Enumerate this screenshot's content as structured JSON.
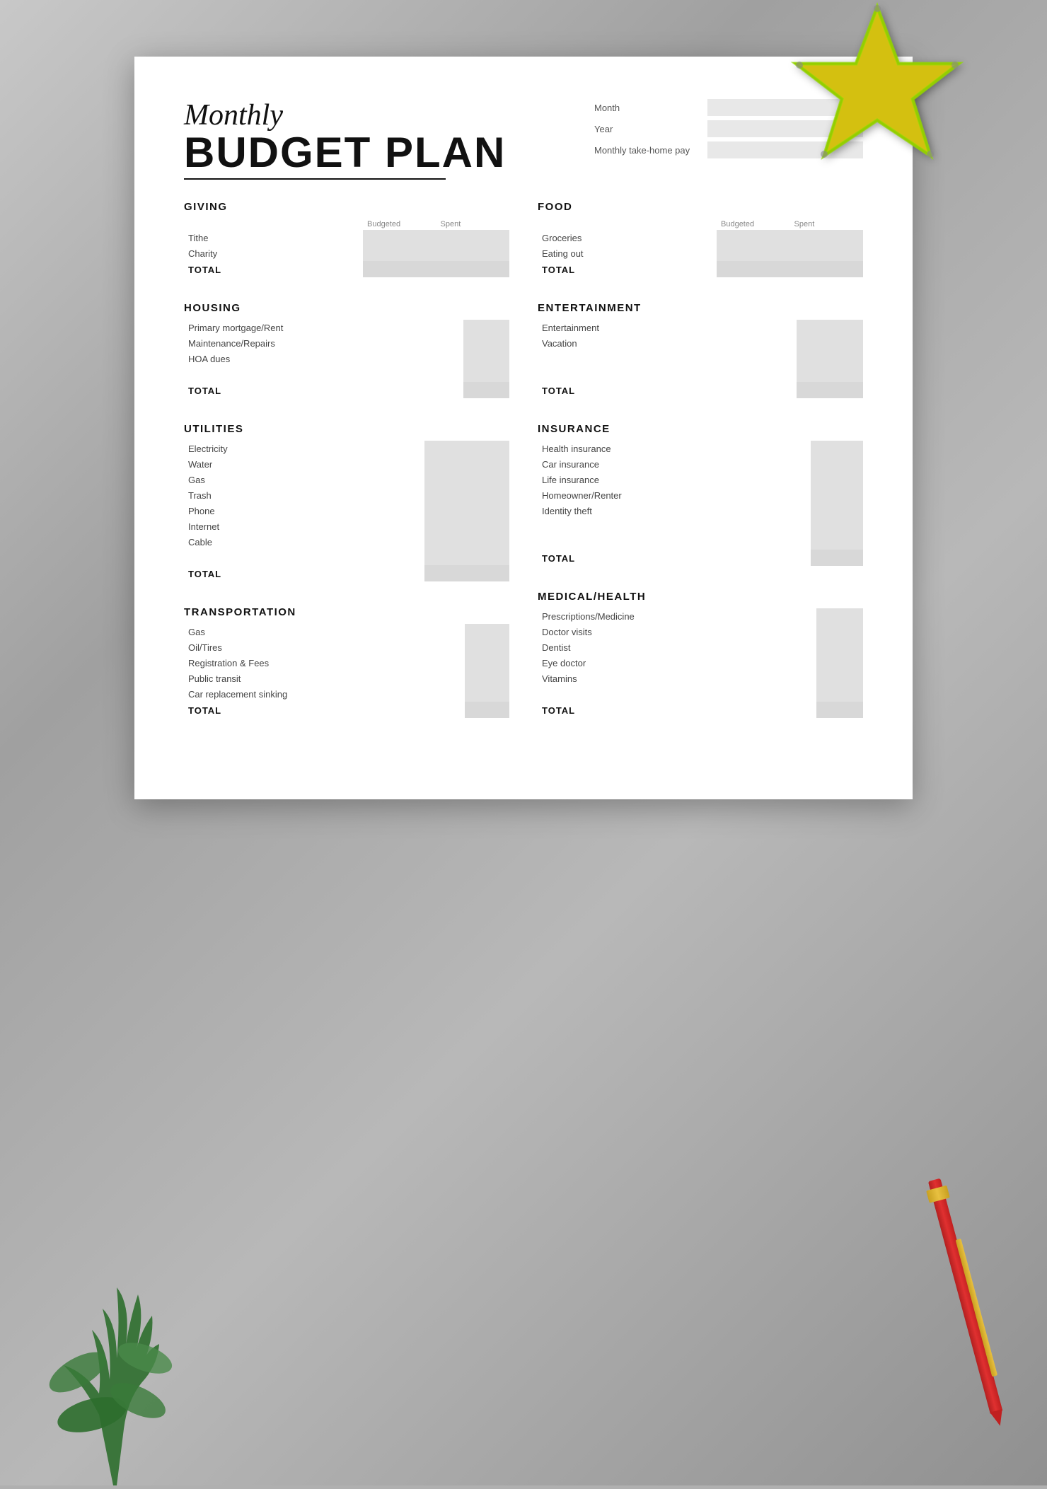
{
  "document": {
    "title_monthly": "Monthly",
    "title_budget": "BUDGET PLAN",
    "info_fields": [
      {
        "label": "Month",
        "value": ""
      },
      {
        "label": "Year",
        "value": ""
      },
      {
        "label": "Monthly take-home pay",
        "value": ""
      }
    ],
    "sections": {
      "left": [
        {
          "id": "giving",
          "title": "GIVING",
          "headers": {
            "col1": "Budgeted",
            "col2": "Spent"
          },
          "rows": [
            {
              "name": "Tithe",
              "b": "",
              "s": ""
            },
            {
              "name": "Charity",
              "b": "",
              "s": ""
            }
          ],
          "empty_rows": 0,
          "total_label": "TOTAL"
        },
        {
          "id": "housing",
          "title": "HOUSING",
          "headers": {
            "col1": "",
            "col2": ""
          },
          "rows": [
            {
              "name": "Primary mortgage/Rent",
              "b": "",
              "s": ""
            },
            {
              "name": "Maintenance/Repairs",
              "b": "",
              "s": ""
            },
            {
              "name": "HOA dues",
              "b": "",
              "s": ""
            }
          ],
          "empty_rows": 1,
          "total_label": "TOTAL"
        },
        {
          "id": "utilities",
          "title": "UTILITIES",
          "headers": {
            "col1": "",
            "col2": ""
          },
          "rows": [
            {
              "name": "Electricity",
              "b": "",
              "s": ""
            },
            {
              "name": "Water",
              "b": "",
              "s": ""
            },
            {
              "name": "Gas",
              "b": "",
              "s": ""
            },
            {
              "name": "Trash",
              "b": "",
              "s": ""
            },
            {
              "name": "Phone",
              "b": "",
              "s": ""
            },
            {
              "name": "Internet",
              "b": "",
              "s": ""
            },
            {
              "name": "Cable",
              "b": "",
              "s": ""
            }
          ],
          "empty_rows": 1,
          "total_label": "TOTAL"
        },
        {
          "id": "transportation",
          "title": "TRANSPORTATION",
          "headers": {
            "col1": "",
            "col2": ""
          },
          "rows": [
            {
              "name": "Gas",
              "b": "",
              "s": ""
            },
            {
              "name": "Oil/Tires",
              "b": "",
              "s": ""
            },
            {
              "name": "Registration & Fees",
              "b": "",
              "s": ""
            },
            {
              "name": "Public transit",
              "b": "",
              "s": ""
            },
            {
              "name": "Car replacement sinking",
              "b": "",
              "s": ""
            }
          ],
          "empty_rows": 0,
          "total_label": "TOTAL"
        }
      ],
      "right": [
        {
          "id": "food",
          "title": "FOOD",
          "headers": {
            "col1": "Budgeted",
            "col2": "Spent"
          },
          "rows": [
            {
              "name": "Groceries",
              "b": "",
              "s": ""
            },
            {
              "name": "Eating out",
              "b": "",
              "s": ""
            }
          ],
          "empty_rows": 0,
          "total_label": "TOTAL"
        },
        {
          "id": "entertainment",
          "title": "ENTERTAINMENT",
          "headers": {
            "col1": "",
            "col2": ""
          },
          "rows": [
            {
              "name": "Entertainment",
              "b": "",
              "s": ""
            },
            {
              "name": "Vacation",
              "b": "",
              "s": ""
            }
          ],
          "empty_rows": 2,
          "total_label": "TOTAL"
        },
        {
          "id": "insurance",
          "title": "INSURANCE",
          "headers": {
            "col1": "",
            "col2": ""
          },
          "rows": [
            {
              "name": "Health insurance",
              "b": "",
              "s": ""
            },
            {
              "name": "Car insurance",
              "b": "",
              "s": ""
            },
            {
              "name": "Life insurance",
              "b": "",
              "s": ""
            },
            {
              "name": "Homeowner/Renter",
              "b": "",
              "s": ""
            },
            {
              "name": "Identity theft",
              "b": "",
              "s": ""
            }
          ],
          "empty_rows": 2,
          "total_label": "TOTAL"
        },
        {
          "id": "medical",
          "title": "MEDICAL/HEALTH",
          "headers": {
            "col1": "",
            "col2": ""
          },
          "rows": [
            {
              "name": "Prescriptions/Medicine",
              "b": "",
              "s": ""
            },
            {
              "name": "Doctor visits",
              "b": "",
              "s": ""
            },
            {
              "name": "Dentist",
              "b": "",
              "s": ""
            },
            {
              "name": "Eye doctor",
              "b": "",
              "s": ""
            },
            {
              "name": "Vitamins",
              "b": "",
              "s": ""
            }
          ],
          "empty_rows": 1,
          "total_label": "TOTAL"
        }
      ]
    }
  }
}
